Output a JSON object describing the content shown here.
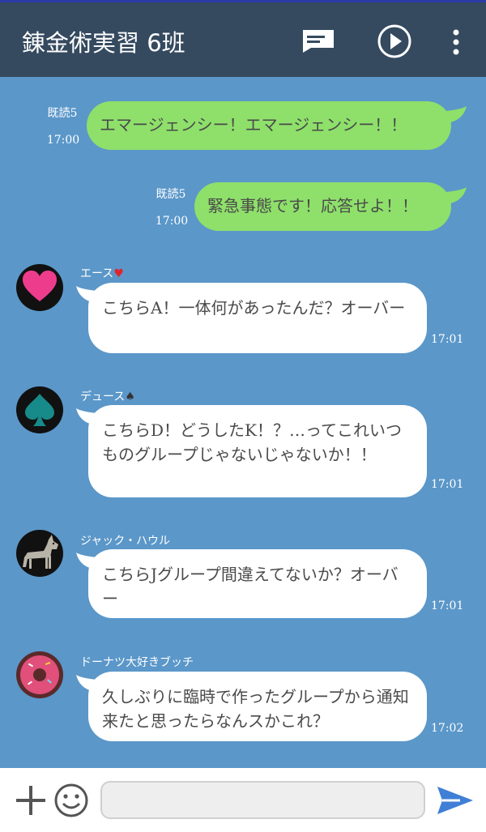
{
  "header": {
    "title": "錬金術実習 6班",
    "icons": [
      "message-icon",
      "play-icon",
      "more-vert-icon"
    ]
  },
  "colors": {
    "header_bg": "#354a5f",
    "chat_bg": "#5b97c9",
    "sent_bubble": "#8ee06a",
    "received_bubble": "#ffffff",
    "send_icon": "#3f7fd6"
  },
  "messages": [
    {
      "direction": "sent",
      "read": "既読5",
      "time": "17:00",
      "text": "エマージェンシー！エマージェンシー！！"
    },
    {
      "direction": "sent",
      "read": "既読5",
      "time": "17:00",
      "text": "緊急事態です！応答せよ！！"
    },
    {
      "direction": "received",
      "sender": "エース",
      "sender_suffix": "♥",
      "time": "17:01",
      "text": "こちらA！一体何があったんだ？オーバー"
    },
    {
      "direction": "received",
      "sender": "デュース",
      "sender_suffix": "♠",
      "time": "17:01",
      "text": "こちらD！どうしたK！？…ってこれいつものグループじゃないじゃないか！！"
    },
    {
      "direction": "received",
      "sender": "ジャック・ハウル",
      "sender_suffix": "",
      "time": "17:01",
      "text": "こちらJグループ間違えてないか？オーバー"
    },
    {
      "direction": "received",
      "sender": "ドーナツ大好きブッチ",
      "sender_suffix": "",
      "time": "17:02",
      "text": "久しぶりに臨時で作ったグループから通知来たと思ったらなんスかこれ？"
    }
  ],
  "composer": {
    "placeholder": "",
    "icons": [
      "plus-icon",
      "emoji-icon",
      "send-icon"
    ]
  }
}
